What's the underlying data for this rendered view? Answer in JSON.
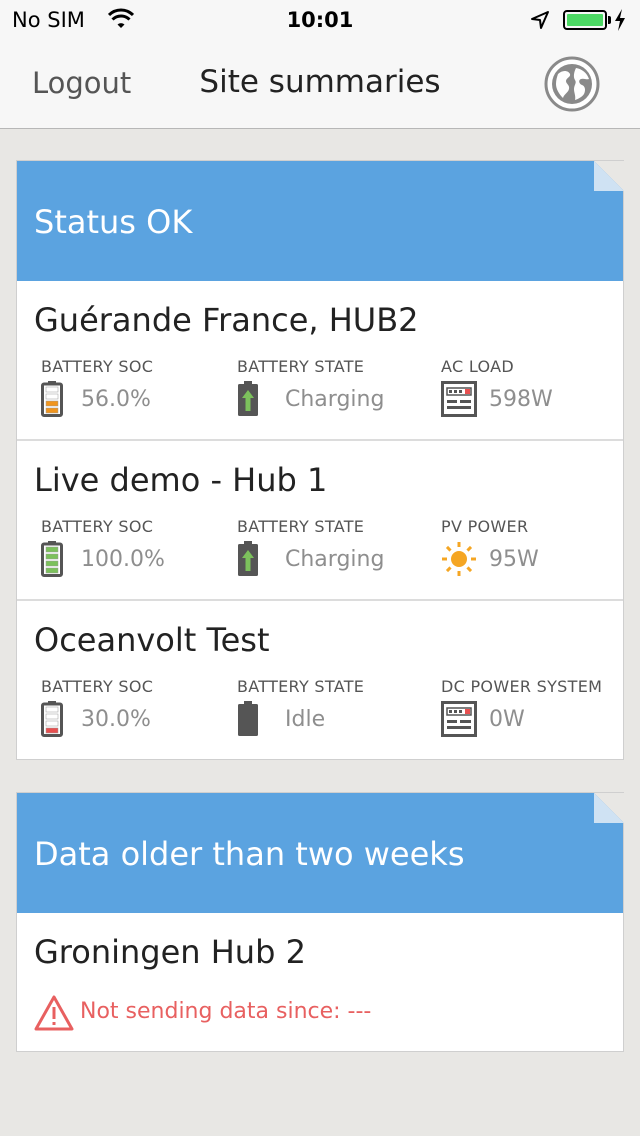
{
  "status_bar": {
    "carrier": "No SIM",
    "time": "10:01"
  },
  "nav": {
    "logout_label": "Logout",
    "title": "Site summaries"
  },
  "groups": [
    {
      "title": "Status OK",
      "sites": [
        {
          "name": "Guérande France, HUB2",
          "metrics": [
            {
              "label": "BATTERY SOC",
              "value": "56.0%",
              "icon": "battery-soc-icon",
              "soc": 0.56,
              "color": "#f0951e"
            },
            {
              "label": "BATTERY STATE",
              "value": "Charging",
              "icon": "battery-charging-icon"
            },
            {
              "label": "AC LOAD",
              "value": "598W",
              "icon": "meter-icon"
            }
          ]
        },
        {
          "name": "Live demo - Hub 1",
          "metrics": [
            {
              "label": "BATTERY SOC",
              "value": "100.0%",
              "icon": "battery-soc-icon",
              "soc": 1.0,
              "color": "#7cc15c"
            },
            {
              "label": "BATTERY STATE",
              "value": "Charging",
              "icon": "battery-charging-icon"
            },
            {
              "label": "PV POWER",
              "value": "95W",
              "icon": "sun-icon"
            }
          ]
        },
        {
          "name": "Oceanvolt Test",
          "metrics": [
            {
              "label": "BATTERY SOC",
              "value": "30.0%",
              "icon": "battery-soc-icon",
              "soc": 0.3,
              "color": "#e85050"
            },
            {
              "label": "BATTERY STATE",
              "value": "Idle",
              "icon": "battery-idle-icon"
            },
            {
              "label": "DC POWER SYSTEM",
              "value": "0W",
              "icon": "meter-icon"
            }
          ]
        }
      ]
    },
    {
      "title": "Data older than two weeks",
      "sites": [
        {
          "name": "Groningen Hub 2",
          "warning": "Not sending data since: ---",
          "warning_icon": "warning-icon"
        }
      ]
    }
  ],
  "colors": {
    "header_blue": "#5ba3e0",
    "warning_red": "#e86060",
    "charge_green": "#7cc15c",
    "sun_orange": "#f5a623"
  }
}
